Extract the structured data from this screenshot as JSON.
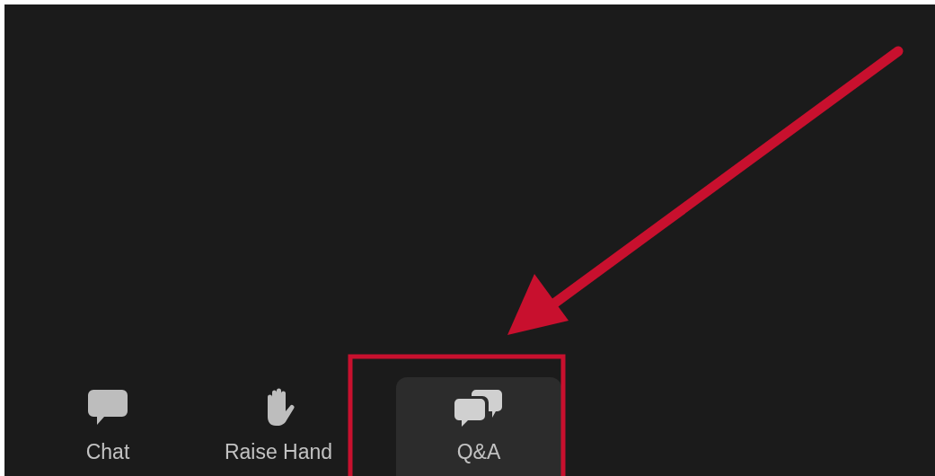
{
  "toolbar": {
    "buttons": [
      {
        "label": "Chat",
        "kind": "chat",
        "selected": false
      },
      {
        "label": "Raise Hand",
        "kind": "hand",
        "selected": false
      },
      {
        "label": "Q&A",
        "kind": "qa",
        "selected": true
      }
    ]
  }
}
